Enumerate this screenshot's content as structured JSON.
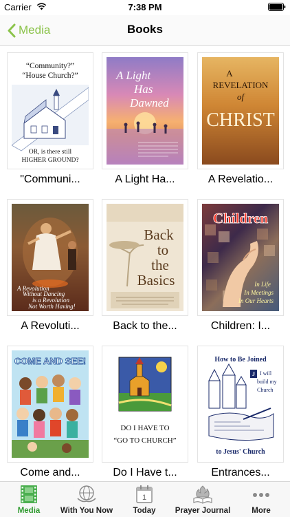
{
  "status": {
    "carrier": "Carrier",
    "time": "7:38 PM"
  },
  "nav": {
    "back_label": "Media",
    "title": "Books"
  },
  "books": [
    {
      "title": "\"Communi..."
    },
    {
      "title": "A Light Ha..."
    },
    {
      "title": "A Revelatio..."
    },
    {
      "title": "A Revoluti..."
    },
    {
      "title": "Back to the..."
    },
    {
      "title": "Children: I..."
    },
    {
      "title": "Come and..."
    },
    {
      "title": "Do I Have t..."
    },
    {
      "title": "Entrances..."
    }
  ],
  "covers": {
    "community": {
      "line1": "“Community?”",
      "line2": "“House Church?”",
      "line3": "OR, is there still",
      "line4": "HIGHER GROUND?"
    },
    "light": {
      "line1": "A Light",
      "line2": "Has",
      "line3": "Dawned"
    },
    "revelation": {
      "line1": "A",
      "line2": "REVELATION",
      "line3": "of",
      "line4": "CHRIST"
    },
    "revolution": {
      "line1": "A Revolution",
      "line2": "Without Dancing",
      "line3": "is a Revolution",
      "line4": "Not Worth Having!"
    },
    "basics": {
      "line1": "Back",
      "line2": "to",
      "line3": "the",
      "line4": "Basics"
    },
    "children": {
      "line1": "Children",
      "line2": "In Life",
      "line3": "In Meetings",
      "line4": "In Our Hearts"
    },
    "come": {
      "line1": "COME AND SEE!"
    },
    "church": {
      "line1": "DO I HAVE TO",
      "line2": "“GO TO CHURCH”"
    },
    "joined": {
      "line1": "How to Be Joined",
      "line2": "I will",
      "line3": "build my",
      "line4": "Church",
      "line5": "to Jesus' Church"
    }
  },
  "tabs": [
    {
      "label": "Media",
      "active": true
    },
    {
      "label": "With You Now",
      "active": false
    },
    {
      "label": "Today",
      "active": false
    },
    {
      "label": "Prayer Journal",
      "active": false
    },
    {
      "label": "More",
      "active": false
    }
  ],
  "colors": {
    "accent": "#8bc34a",
    "tab_active": "#2f9a2f"
  }
}
